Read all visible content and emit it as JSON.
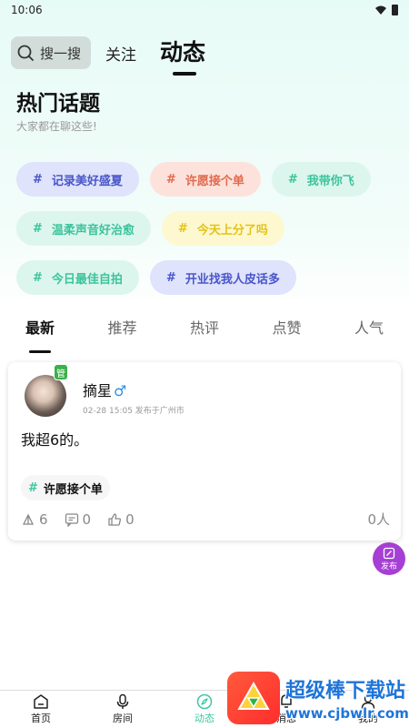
{
  "status_bar": {
    "time": "10:06"
  },
  "top_nav": {
    "search_placeholder": "搜一搜",
    "tab_follow": "关注",
    "tab_dynamic": "动态"
  },
  "hot_topics": {
    "title": "热门话题",
    "subtitle": "大家都在聊这些!",
    "items": [
      {
        "hash": "#",
        "label": "记录美好盛夏",
        "bg": "#dfe3fb",
        "color": "#4a56c9"
      },
      {
        "hash": "#",
        "label": "许愿接个单",
        "bg": "#fde2dc",
        "color": "#e06a4d"
      },
      {
        "hash": "#",
        "label": "我带你飞",
        "bg": "#dcf6ee",
        "color": "#3cc39b"
      },
      {
        "hash": "#",
        "label": "温柔声音好治愈",
        "bg": "#dcf6ee",
        "color": "#3cc39b"
      },
      {
        "hash": "#",
        "label": "今天上分了吗",
        "bg": "#fdf8cf",
        "color": "#e3c318"
      },
      {
        "hash": "#",
        "label": "今日最佳自拍",
        "bg": "#dcf6ee",
        "color": "#3cc39b"
      },
      {
        "hash": "#",
        "label": "开业找我人皮话多",
        "bg": "#dfe3fb",
        "color": "#4a56c9"
      }
    ]
  },
  "feed_tabs": [
    "最新",
    "推荐",
    "热评",
    "点赞",
    "人气"
  ],
  "post": {
    "admin_badge": "管",
    "username": "摘星",
    "gender": "♂",
    "meta": "02-28 15:05 发布于广州市",
    "content": "我超6的。",
    "topic_hash": "#",
    "topic": "许愿接个单",
    "gift_count": "6",
    "comment_count": "0",
    "like_count": "0",
    "people": "0人"
  },
  "publish_button": "发布",
  "bottom_nav": [
    {
      "label": "首页",
      "icon": "home-icon"
    },
    {
      "label": "房间",
      "icon": "mic-icon"
    },
    {
      "label": "动态",
      "icon": "compass-icon"
    },
    {
      "label": "消息",
      "icon": "message-icon"
    },
    {
      "label": "我的",
      "icon": "user-icon"
    }
  ],
  "watermark": {
    "title": "超级棒下载站",
    "url": "www.cjbwlr.com"
  },
  "colors": {
    "accent": "#3ec7a0",
    "publish": "#a63fd3",
    "gender": "#2f8ee0",
    "admin": "#3cb04a"
  }
}
